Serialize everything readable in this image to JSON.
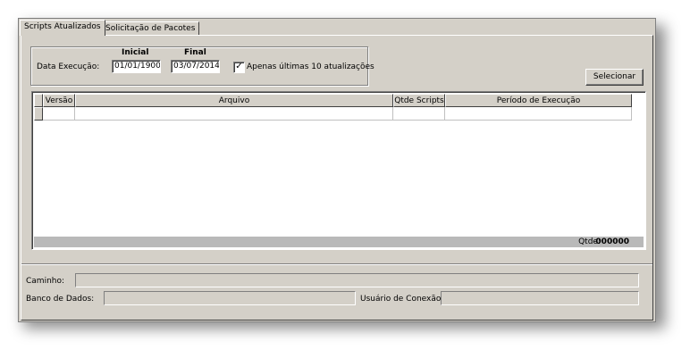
{
  "tabs": [
    {
      "label": "Scripts Atualizados"
    },
    {
      "label": "Solicitação de Pacotes"
    }
  ],
  "filter": {
    "data_execucao_label": "Data Execução:",
    "inicial_label": "Inicial",
    "final_label": "Final",
    "inicial_value": "01/01/1900",
    "final_value": "03/07/2014",
    "checkbox_label": "Apenas últimas 10 atualizações",
    "checkbox_checked": true
  },
  "selecionar_label": "Selecionar",
  "grid": {
    "columns": [
      "Versão",
      "Arquivo",
      "Qtde Scripts",
      "Período de Execução"
    ]
  },
  "footer": {
    "qtde_label": "Qtde:",
    "qtde_value": "000000"
  },
  "details": {
    "caminho_label": "Caminho:",
    "banco_label": "Banco de Dados:",
    "usuario_label": "Usuário de Conexão:"
  }
}
